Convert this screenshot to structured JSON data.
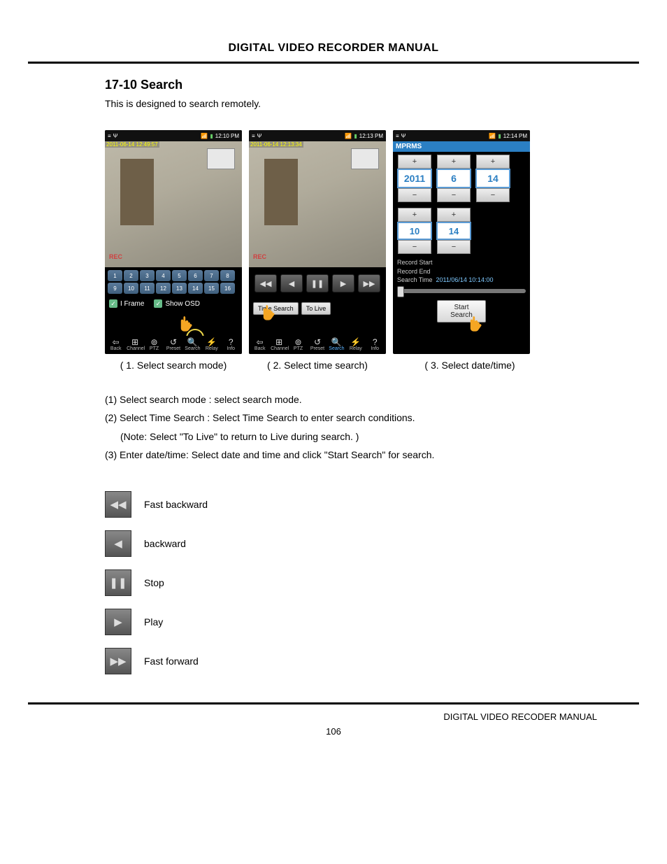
{
  "header": "DIGITAL VIDEO RECORDER MANUAL",
  "section": "17-10 Search",
  "intro": "This is designed to search remotely.",
  "phone1": {
    "time": "12:10 PM",
    "ts": "2011-06-14 12:49:57",
    "rec": "REC",
    "channels": [
      "1",
      "2",
      "3",
      "4",
      "5",
      "6",
      "7",
      "8",
      "9",
      "10",
      "11",
      "12",
      "13",
      "14",
      "15",
      "16"
    ],
    "chk_iframe": "I Frame",
    "chk_osd": "Show OSD"
  },
  "phone2": {
    "time": "12:13 PM",
    "ts": "2011-06-14 12:13:34",
    "rec": "REC",
    "btn_timesearch": "Time Search",
    "btn_tolive": "To Live"
  },
  "phone3": {
    "time": "12:14 PM",
    "title": "MPRMS",
    "year": "2011",
    "month": "6",
    "day": "14",
    "hour": "10",
    "minute": "14",
    "rec_start": "Record Start",
    "rec_end": "Record End",
    "search_time_label": "Search Time",
    "search_time_val": "2011/06/14 10:14:00",
    "start_search": "Start Search"
  },
  "toolbar": {
    "back": "Back",
    "channel": "Channel",
    "ptz": "PTZ",
    "preset": "Preset",
    "search": "Search",
    "relay": "Relay",
    "info": "Info"
  },
  "captions": {
    "c1": "( 1. Select search mode)",
    "c2": "( 2. Select time search)",
    "c3": "( 3. Select date/time)"
  },
  "steps": {
    "s1": "(1) Select search mode : select search mode.",
    "s2": "(2) Select Time Search : Select Time Search to enter search conditions.",
    "s2note": "(Note:   Select \"To Live\" to return to Live during search. )",
    "s3": "(3) Enter date/time: Select date and time and click \"Start Search\" for search."
  },
  "legend": {
    "fb": "Fast backward",
    "bw": "backward",
    "stop": "Stop",
    "play": "Play",
    "ff": "Fast forward"
  },
  "footer": "DIGITAL VIDEO RECODER MANUAL",
  "page": "106"
}
